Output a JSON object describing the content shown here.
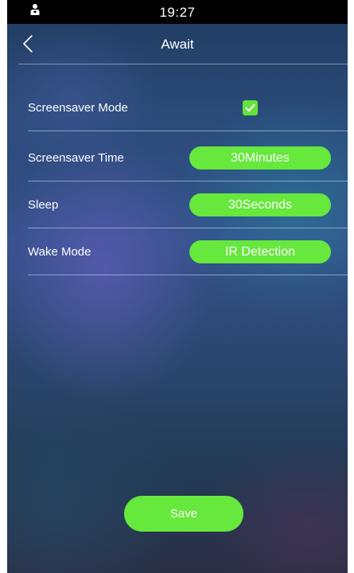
{
  "status_bar": {
    "time": "19:27",
    "user_icon": "user-icon"
  },
  "header": {
    "title": "Await",
    "back_icon": "chevron-left-icon"
  },
  "settings": {
    "screensaver_mode": {
      "label": "Screensaver Mode",
      "checked": true
    },
    "screensaver_time": {
      "label": "Screensaver Time",
      "value": "30Minutes"
    },
    "sleep": {
      "label": "Sleep",
      "value": "30Seconds"
    },
    "wake_mode": {
      "label": "Wake Mode",
      "value": "IR Detection"
    }
  },
  "actions": {
    "save_label": "Save"
  },
  "colors": {
    "accent": "#66e83d",
    "text": "#ffffff",
    "status_bar_bg": "#000000"
  }
}
